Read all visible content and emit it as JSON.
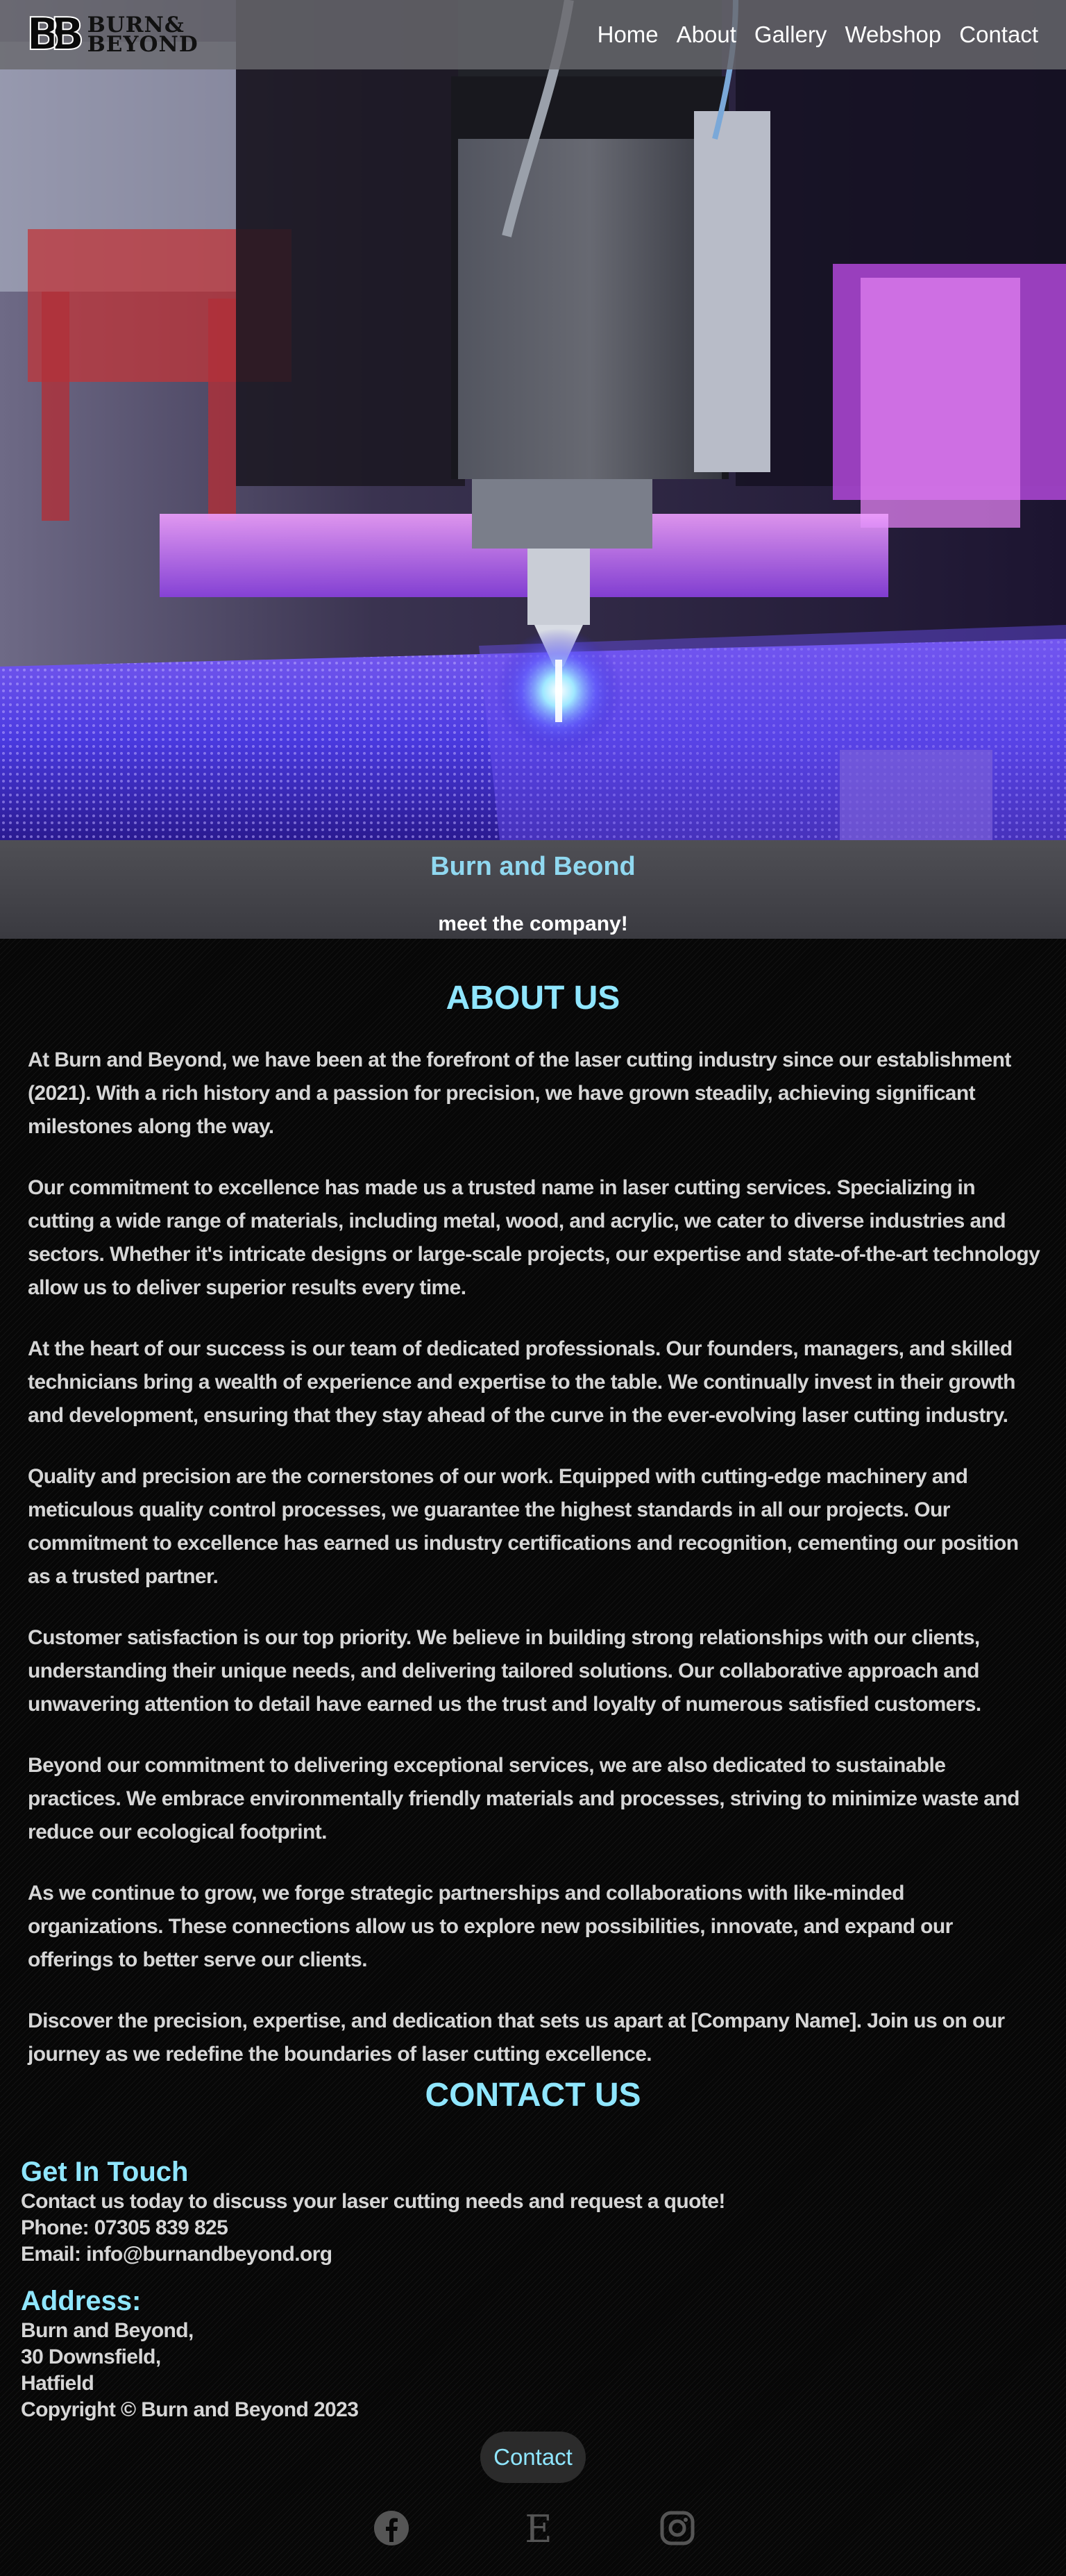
{
  "header": {
    "logo_text_line1": "BURN&",
    "logo_text_line2": "BEYOND",
    "nav": [
      "Home",
      "About",
      "Gallery",
      "Webshop",
      "Contact"
    ]
  },
  "banner": {
    "title": "Burn and Beond",
    "subtitle": "meet the company!"
  },
  "about": {
    "heading": "ABOUT US",
    "paragraphs": [
      "At Burn and Beyond, we have been at the forefront of the laser cutting industry since our establishment (2021). With a rich history and a passion for precision, we have grown steadily, achieving significant milestones along the way.",
      "Our commitment to excellence has made us a trusted name in laser cutting services. Specializing in cutting a wide range of materials, including metal, wood, and acrylic, we cater to diverse industries and sectors. Whether it's intricate designs or large-scale projects, our expertise and state-of-the-art technology allow us to deliver superior results every time.",
      "At the heart of our success is our team of dedicated professionals. Our founders, managers, and skilled technicians bring a wealth of experience and expertise to the table. We continually invest in their growth and development, ensuring that they stay ahead of the curve in the ever-evolving laser cutting industry.",
      "Quality and precision are the cornerstones of our work. Equipped with cutting-edge machinery and meticulous quality control processes, we guarantee the highest standards in all our projects. Our commitment to excellence has earned us industry certifications and recognition, cementing our position as a trusted partner.",
      "Customer satisfaction is our top priority. We believe in building strong relationships with our clients, understanding their unique needs, and delivering tailored solutions. Our collaborative approach and unwavering attention to detail have earned us the trust and loyalty of numerous satisfied customers.",
      "Beyond our commitment to delivering exceptional services, we are also dedicated to sustainable practices. We embrace environmentally friendly materials and processes, striving to minimize waste and reduce our ecological footprint.",
      "As we continue to grow, we forge strategic partnerships and collaborations with like-minded organizations. These connections allow us to explore new possibilities, innovate, and expand our offerings to better serve our clients.",
      "Discover the precision, expertise, and dedication that sets us apart at [Company Name]. Join us on our journey as we redefine the boundaries of laser cutting excellence."
    ]
  },
  "contact": {
    "heading": "CONTACT US",
    "get_in_touch": "Get In Touch",
    "intro": "Contact us today to discuss your laser cutting needs and request a quote!",
    "phone": "Phone: 07305 839 825",
    "email": "Email: info@burnandbeyond.org",
    "address_heading": "Address:",
    "address_lines": [
      "Burn and Beyond,",
      "30 Downsfield,",
      "Hatfield"
    ],
    "copyright": "Copyright © Burn and Beyond 2023",
    "button_label": "Contact"
  },
  "social": {
    "icons": [
      "facebook-icon",
      "etsy-icon",
      "instagram-icon"
    ],
    "etsy_letter": "E"
  },
  "colors": {
    "accent": "#8fe6ff",
    "banner_title": "#90d8f0",
    "text": "#d6d6d6",
    "background": "#070707"
  }
}
